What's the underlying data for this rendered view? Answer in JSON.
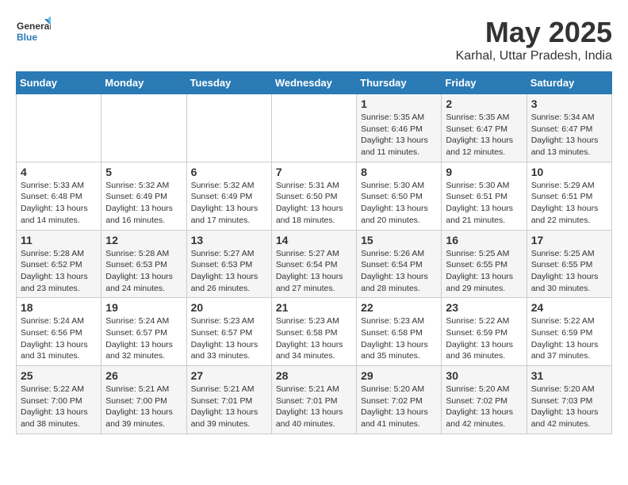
{
  "logo": {
    "line1": "General",
    "line2": "Blue"
  },
  "title": "May 2025",
  "subtitle": "Karhal, Uttar Pradesh, India",
  "days_of_week": [
    "Sunday",
    "Monday",
    "Tuesday",
    "Wednesday",
    "Thursday",
    "Friday",
    "Saturday"
  ],
  "weeks": [
    [
      {
        "day": "",
        "info": ""
      },
      {
        "day": "",
        "info": ""
      },
      {
        "day": "",
        "info": ""
      },
      {
        "day": "",
        "info": ""
      },
      {
        "day": "1",
        "info": "Sunrise: 5:35 AM\nSunset: 6:46 PM\nDaylight: 13 hours\nand 11 minutes."
      },
      {
        "day": "2",
        "info": "Sunrise: 5:35 AM\nSunset: 6:47 PM\nDaylight: 13 hours\nand 12 minutes."
      },
      {
        "day": "3",
        "info": "Sunrise: 5:34 AM\nSunset: 6:47 PM\nDaylight: 13 hours\nand 13 minutes."
      }
    ],
    [
      {
        "day": "4",
        "info": "Sunrise: 5:33 AM\nSunset: 6:48 PM\nDaylight: 13 hours\nand 14 minutes."
      },
      {
        "day": "5",
        "info": "Sunrise: 5:32 AM\nSunset: 6:49 PM\nDaylight: 13 hours\nand 16 minutes."
      },
      {
        "day": "6",
        "info": "Sunrise: 5:32 AM\nSunset: 6:49 PM\nDaylight: 13 hours\nand 17 minutes."
      },
      {
        "day": "7",
        "info": "Sunrise: 5:31 AM\nSunset: 6:50 PM\nDaylight: 13 hours\nand 18 minutes."
      },
      {
        "day": "8",
        "info": "Sunrise: 5:30 AM\nSunset: 6:50 PM\nDaylight: 13 hours\nand 20 minutes."
      },
      {
        "day": "9",
        "info": "Sunrise: 5:30 AM\nSunset: 6:51 PM\nDaylight: 13 hours\nand 21 minutes."
      },
      {
        "day": "10",
        "info": "Sunrise: 5:29 AM\nSunset: 6:51 PM\nDaylight: 13 hours\nand 22 minutes."
      }
    ],
    [
      {
        "day": "11",
        "info": "Sunrise: 5:28 AM\nSunset: 6:52 PM\nDaylight: 13 hours\nand 23 minutes."
      },
      {
        "day": "12",
        "info": "Sunrise: 5:28 AM\nSunset: 6:53 PM\nDaylight: 13 hours\nand 24 minutes."
      },
      {
        "day": "13",
        "info": "Sunrise: 5:27 AM\nSunset: 6:53 PM\nDaylight: 13 hours\nand 26 minutes."
      },
      {
        "day": "14",
        "info": "Sunrise: 5:27 AM\nSunset: 6:54 PM\nDaylight: 13 hours\nand 27 minutes."
      },
      {
        "day": "15",
        "info": "Sunrise: 5:26 AM\nSunset: 6:54 PM\nDaylight: 13 hours\nand 28 minutes."
      },
      {
        "day": "16",
        "info": "Sunrise: 5:25 AM\nSunset: 6:55 PM\nDaylight: 13 hours\nand 29 minutes."
      },
      {
        "day": "17",
        "info": "Sunrise: 5:25 AM\nSunset: 6:55 PM\nDaylight: 13 hours\nand 30 minutes."
      }
    ],
    [
      {
        "day": "18",
        "info": "Sunrise: 5:24 AM\nSunset: 6:56 PM\nDaylight: 13 hours\nand 31 minutes."
      },
      {
        "day": "19",
        "info": "Sunrise: 5:24 AM\nSunset: 6:57 PM\nDaylight: 13 hours\nand 32 minutes."
      },
      {
        "day": "20",
        "info": "Sunrise: 5:23 AM\nSunset: 6:57 PM\nDaylight: 13 hours\nand 33 minutes."
      },
      {
        "day": "21",
        "info": "Sunrise: 5:23 AM\nSunset: 6:58 PM\nDaylight: 13 hours\nand 34 minutes."
      },
      {
        "day": "22",
        "info": "Sunrise: 5:23 AM\nSunset: 6:58 PM\nDaylight: 13 hours\nand 35 minutes."
      },
      {
        "day": "23",
        "info": "Sunrise: 5:22 AM\nSunset: 6:59 PM\nDaylight: 13 hours\nand 36 minutes."
      },
      {
        "day": "24",
        "info": "Sunrise: 5:22 AM\nSunset: 6:59 PM\nDaylight: 13 hours\nand 37 minutes."
      }
    ],
    [
      {
        "day": "25",
        "info": "Sunrise: 5:22 AM\nSunset: 7:00 PM\nDaylight: 13 hours\nand 38 minutes."
      },
      {
        "day": "26",
        "info": "Sunrise: 5:21 AM\nSunset: 7:00 PM\nDaylight: 13 hours\nand 39 minutes."
      },
      {
        "day": "27",
        "info": "Sunrise: 5:21 AM\nSunset: 7:01 PM\nDaylight: 13 hours\nand 39 minutes."
      },
      {
        "day": "28",
        "info": "Sunrise: 5:21 AM\nSunset: 7:01 PM\nDaylight: 13 hours\nand 40 minutes."
      },
      {
        "day": "29",
        "info": "Sunrise: 5:20 AM\nSunset: 7:02 PM\nDaylight: 13 hours\nand 41 minutes."
      },
      {
        "day": "30",
        "info": "Sunrise: 5:20 AM\nSunset: 7:02 PM\nDaylight: 13 hours\nand 42 minutes."
      },
      {
        "day": "31",
        "info": "Sunrise: 5:20 AM\nSunset: 7:03 PM\nDaylight: 13 hours\nand 42 minutes."
      }
    ]
  ]
}
